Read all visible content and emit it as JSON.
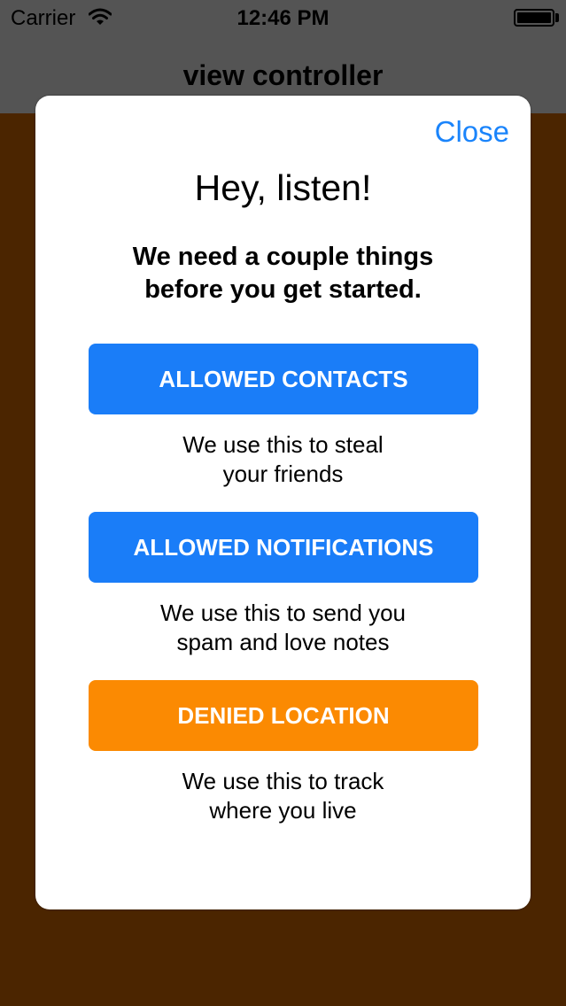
{
  "status_bar": {
    "carrier": "Carrier",
    "time": "12:46 PM",
    "wifi_icon": "wifi-icon",
    "battery_icon": "battery-icon"
  },
  "nav_bar": {
    "title": "view controller"
  },
  "modal": {
    "close_label": "Close",
    "title": "Hey, listen!",
    "subtitle_line1": "We need a couple things",
    "subtitle_line2": "before you get started.",
    "permissions": [
      {
        "button_label": "ALLOWED CONTACTS",
        "description_line1": "We use this to steal",
        "description_line2": "your friends",
        "color": "#1a7df8"
      },
      {
        "button_label": "ALLOWED NOTIFICATIONS",
        "description_line1": "We use this to send you",
        "description_line2": "spam and love notes",
        "color": "#1a7df8"
      },
      {
        "button_label": "DENIED LOCATION",
        "description_line1": "We use this to track",
        "description_line2": "where you live",
        "color": "#fb8a02"
      }
    ]
  },
  "colors": {
    "background": "#4b2500",
    "bar": "#545454",
    "accent": "#1a84fb",
    "allowed": "#1a7df8",
    "denied": "#fb8a02"
  }
}
